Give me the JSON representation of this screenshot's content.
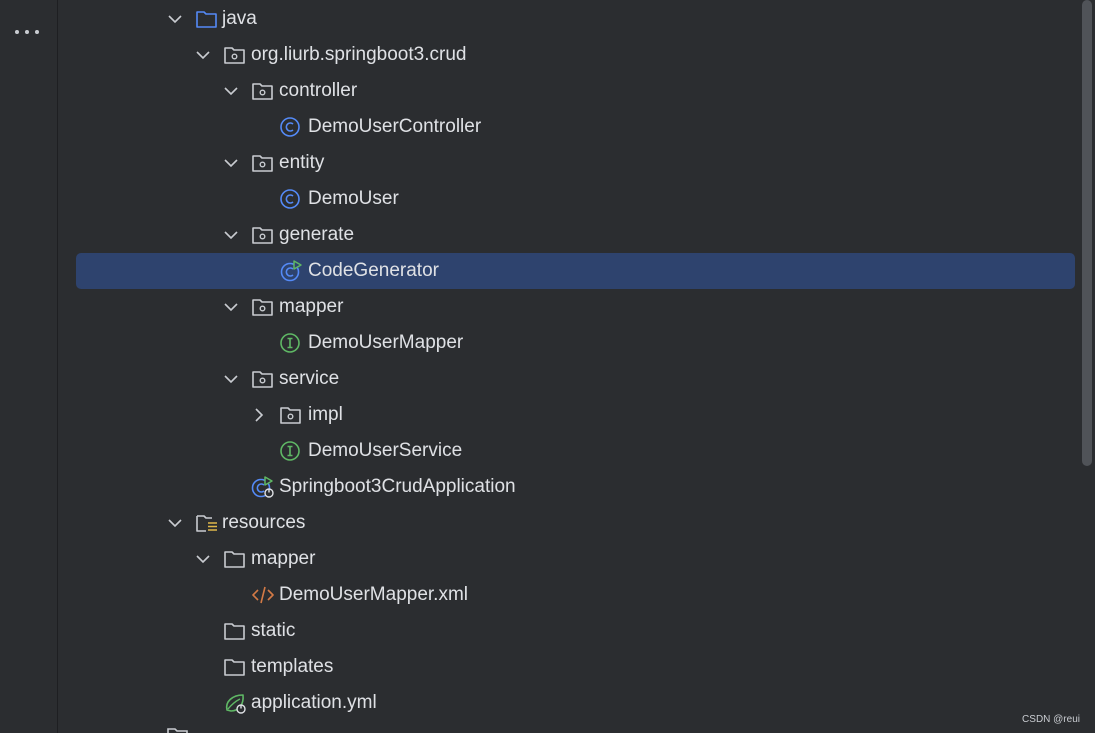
{
  "tree": {
    "items": [
      {
        "label": "java",
        "icon": "source-folder-icon",
        "expanded": true
      },
      {
        "label": "org.liurb.springboot3.crud",
        "icon": "package-icon",
        "expanded": true
      },
      {
        "label": "controller",
        "icon": "package-icon",
        "expanded": true
      },
      {
        "label": "DemoUserController",
        "icon": "class-icon"
      },
      {
        "label": "entity",
        "icon": "package-icon",
        "expanded": true
      },
      {
        "label": "DemoUser",
        "icon": "class-icon"
      },
      {
        "label": "generate",
        "icon": "package-icon",
        "expanded": true
      },
      {
        "label": "CodeGenerator",
        "icon": "runnable-class-icon",
        "selected": true
      },
      {
        "label": "mapper",
        "icon": "package-icon",
        "expanded": true
      },
      {
        "label": "DemoUserMapper",
        "icon": "interface-icon"
      },
      {
        "label": "service",
        "icon": "package-icon",
        "expanded": true
      },
      {
        "label": "impl",
        "icon": "package-icon",
        "expanded": false
      },
      {
        "label": "DemoUserService",
        "icon": "interface-icon"
      },
      {
        "label": "Springboot3CrudApplication",
        "icon": "spring-boot-class-icon"
      },
      {
        "label": "resources",
        "icon": "resources-folder-icon",
        "expanded": true
      },
      {
        "label": "mapper",
        "icon": "folder-icon",
        "expanded": true
      },
      {
        "label": "DemoUserMapper.xml",
        "icon": "xml-file-icon"
      },
      {
        "label": "static",
        "icon": "folder-icon"
      },
      {
        "label": "templates",
        "icon": "folder-icon"
      },
      {
        "label": "application.yml",
        "icon": "spring-config-icon"
      }
    ]
  },
  "watermark": "CSDN @reui",
  "colors": {
    "background": "#2b2d30",
    "selection": "#2e436e",
    "text": "#dfe1e5",
    "class_icon": "#548af7",
    "interface_icon": "#5fb865",
    "xml_icon": "#d47a46",
    "spring_icon": "#5fb865"
  }
}
